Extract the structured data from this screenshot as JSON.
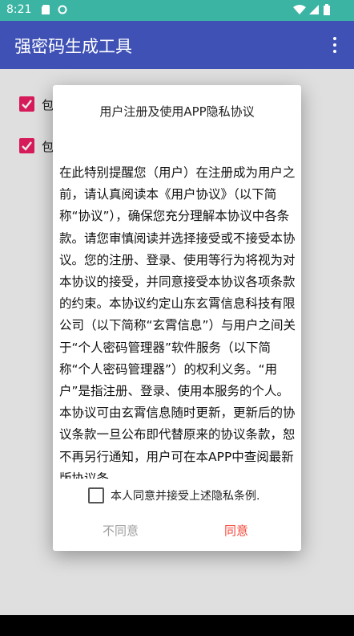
{
  "status_bar": {
    "time": "8:21",
    "icons": [
      "sd-card-icon",
      "sync-icon",
      "wifi-icon",
      "signal-icon",
      "battery-icon"
    ]
  },
  "app_bar": {
    "title": "强密码生成工具",
    "menu_icon": "more-vert-icon"
  },
  "background": {
    "options": [
      {
        "label": "包",
        "checked": true
      },
      {
        "label": "包",
        "checked": true
      }
    ]
  },
  "dialog": {
    "title": "用户注册及使用APP隐私协议",
    "body": "在此特别提醒您（用户）在注册成为用户之前，请认真阅读本《用户协议》（以下简称“协议”），确保您充分理解本协议中各条款。请您审慎阅读并选择接受或不接受本协议。您的注册、登录、使用等行为将视为对本协议的接受，并同意接受本协议各项条款的约束。本协议约定山东玄霄信息科技有限公司（以下简称“玄霄信息”）与用户之间关于“个人密码管理器”软件服务（以下简称“个人密码管理器”）的权利义务。“用户”是指注册、登录、使用本服务的个人。本协议可由玄霄信息随时更新，更新后的协议条款一旦公布即代替原来的协议条款，恕不再另行通知，用户可在本APP中查阅最新版协议条",
    "agree_checkbox_label": "本人同意并接受上述隐私条例.",
    "agree_checked": false,
    "disagree_button": "不同意",
    "agree_button": "同意"
  },
  "colors": {
    "status_bar": "#3cb4a4",
    "app_bar": "#3f51b5",
    "checkbox": "#e91e63",
    "agree_button": "#f44336",
    "disagree_button": "#9e9e9e"
  }
}
